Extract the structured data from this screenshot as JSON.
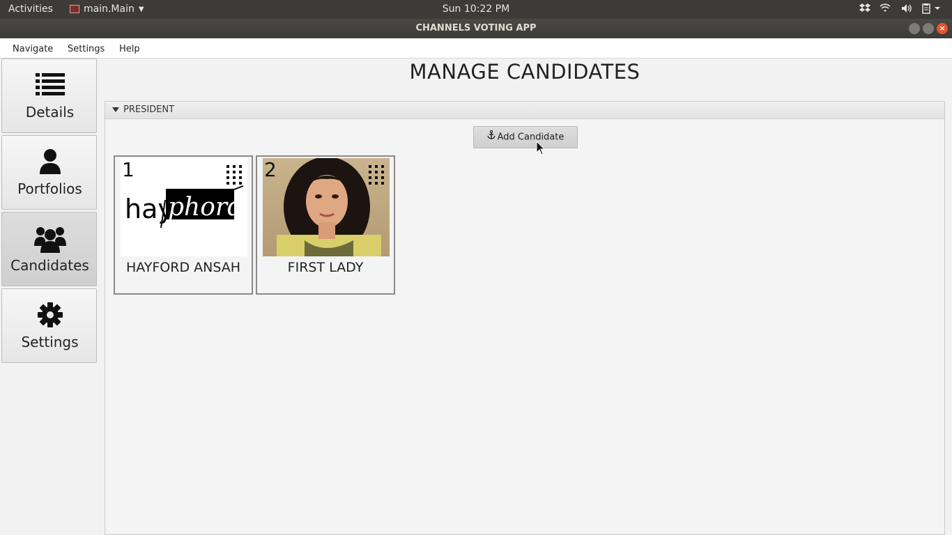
{
  "topbar": {
    "activities": "Activities",
    "app_menu": "main.Main",
    "clock": "Sun 10:22 PM"
  },
  "window": {
    "title": "CHANNELS VOTING APP"
  },
  "menubar": {
    "items": [
      "Navigate",
      "Settings",
      "Help"
    ]
  },
  "sidebar": {
    "items": [
      {
        "label": "Details",
        "icon": "list-icon"
      },
      {
        "label": "Portfolios",
        "icon": "user-icon"
      },
      {
        "label": "Candidates",
        "icon": "users-icon",
        "active": true
      },
      {
        "label": "Settings",
        "icon": "gear-icon"
      }
    ]
  },
  "main": {
    "title": "MANAGE CANDIDATES",
    "section": {
      "label": "PRESIDENT",
      "add_button": "Add Candidate",
      "candidates": [
        {
          "number": "1",
          "name": "HAYFORD ANSAH",
          "logo_text": "hay phord"
        },
        {
          "number": "2",
          "name": "FIRST LADY"
        }
      ]
    }
  },
  "colors": {
    "topbar_bg": "#3c3b37",
    "close_button": "#e9542c"
  }
}
